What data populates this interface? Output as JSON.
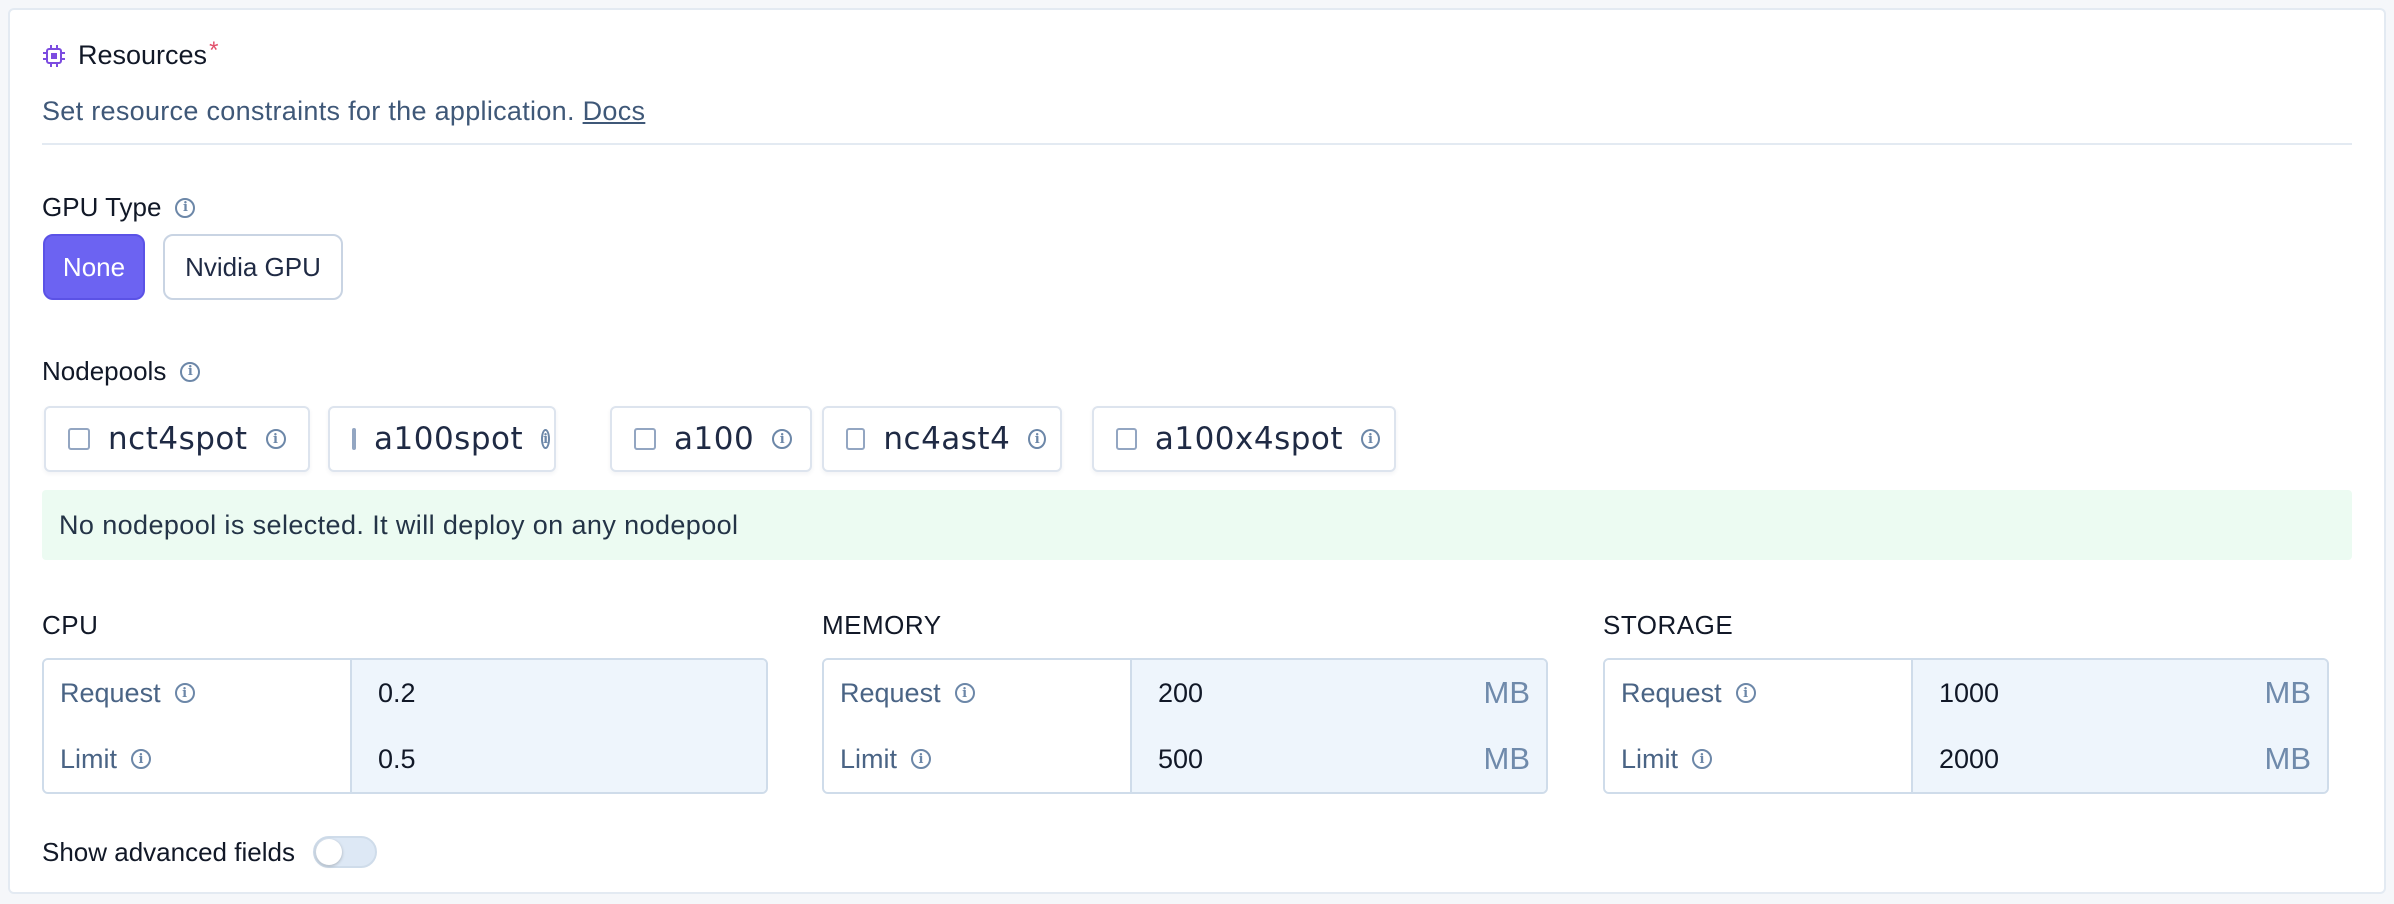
{
  "header": {
    "title": "Resources",
    "required_marker": "*",
    "description": "Set resource constraints for the application.",
    "docs_link": "Docs",
    "icon": "cpu-chip-icon",
    "icon_color": "#7c4ce0"
  },
  "gpu": {
    "label": "GPU Type",
    "options": [
      "None",
      "Nvidia GPU"
    ],
    "selected": "None",
    "accent_color": "#6c63f2"
  },
  "nodepools": {
    "label": "Nodepools",
    "items": [
      "nct4spot",
      "a100spot",
      "a100",
      "nc4ast4",
      "a100x4spot"
    ],
    "notice": "No nodepool is selected. It will deploy on any nodepool"
  },
  "resources": {
    "cpu": {
      "title": "CPU",
      "request_label": "Request",
      "request_value": "0.2",
      "request_unit": "",
      "limit_label": "Limit",
      "limit_value": "0.5",
      "limit_unit": ""
    },
    "memory": {
      "title": "MEMORY",
      "request_label": "Request",
      "request_value": "200",
      "request_unit": "MB",
      "limit_label": "Limit",
      "limit_value": "500",
      "limit_unit": "MB"
    },
    "storage": {
      "title": "STORAGE",
      "request_label": "Request",
      "request_value": "1000",
      "request_unit": "MB",
      "limit_label": "Limit",
      "limit_value": "2000",
      "limit_unit": "MB"
    }
  },
  "advanced": {
    "label": "Show advanced fields",
    "enabled": false
  }
}
